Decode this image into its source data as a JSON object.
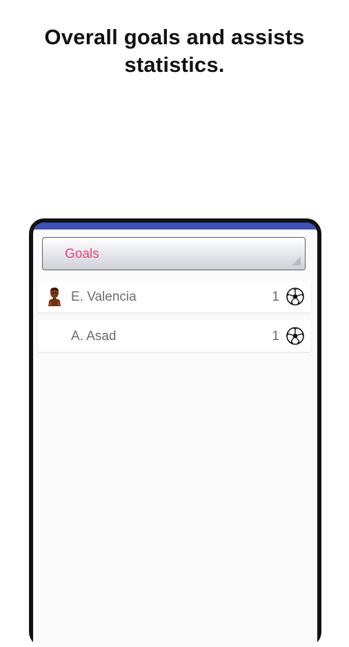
{
  "headline": {
    "line1": "Overall goals and assists",
    "line2": "statistics."
  },
  "app": {
    "accent_color": "#3f51b5",
    "dropdown": {
      "selected": "Goals",
      "text_color": "#ec407a"
    },
    "players": [
      {
        "name": "E. Valencia",
        "count": "1",
        "has_avatar": true,
        "stat_icon": "soccer-ball-icon"
      },
      {
        "name": "A. Asad",
        "count": "1",
        "has_avatar": false,
        "stat_icon": "soccer-ball-icon"
      }
    ]
  }
}
